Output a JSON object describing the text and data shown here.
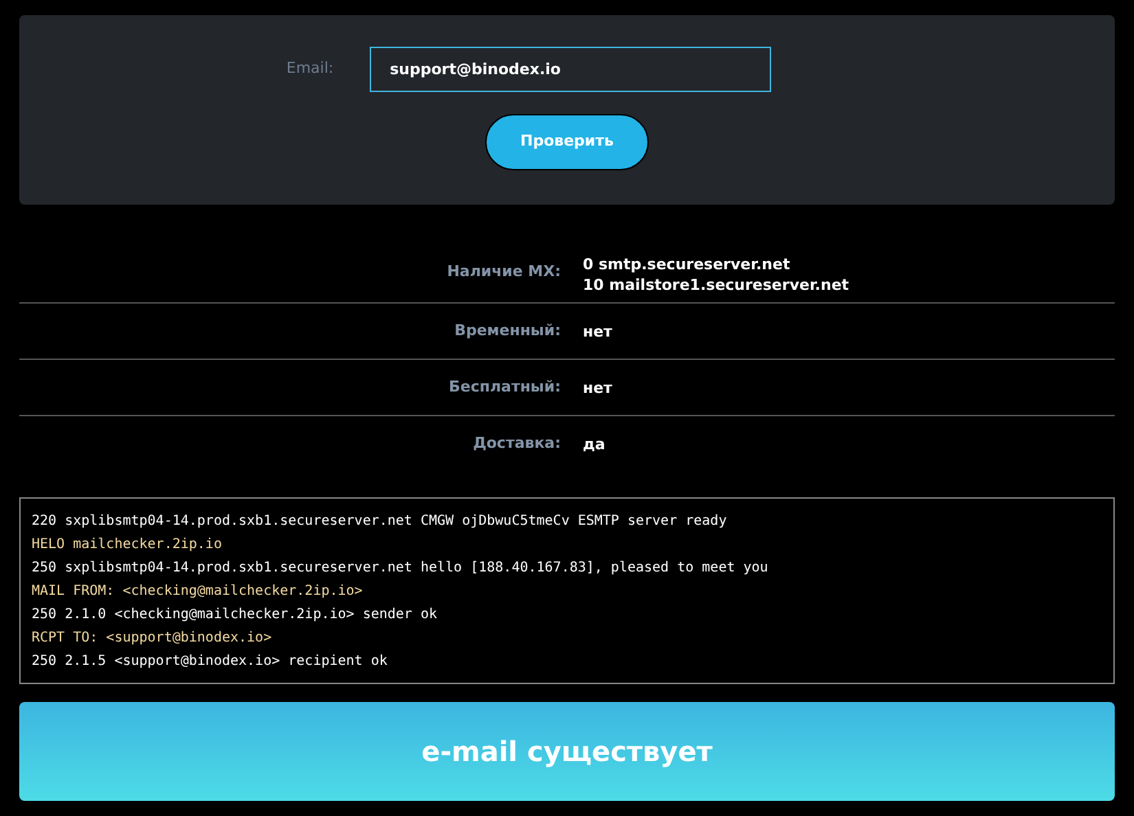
{
  "form": {
    "label": "Email:",
    "value": "support@binodex.io",
    "button": "Проверить"
  },
  "results": [
    {
      "label": "Наличие MX:",
      "values": [
        "0 smtp.secureserver.net",
        "10 mailstore1.secureserver.net"
      ]
    },
    {
      "label": "Временный:",
      "values": [
        "нет"
      ]
    },
    {
      "label": "Бесплатный:",
      "values": [
        "нет"
      ]
    },
    {
      "label": "Доставка:",
      "values": [
        "да"
      ]
    }
  ],
  "log": [
    {
      "kind": "server",
      "text": "220 sxplibsmtp04-14.prod.sxb1.secureserver.net CMGW ojDbwuC5tmeCv ESMTP server ready"
    },
    {
      "kind": "client",
      "text": "HELO mailchecker.2ip.io"
    },
    {
      "kind": "server",
      "text": "250 sxplibsmtp04-14.prod.sxb1.secureserver.net hello [188.40.167.83], pleased to meet you"
    },
    {
      "kind": "client",
      "text": "MAIL FROM: <checking@mailchecker.2ip.io>"
    },
    {
      "kind": "server",
      "text": "250 2.1.0 <checking@mailchecker.2ip.io> sender ok"
    },
    {
      "kind": "client",
      "text": "RCPT TO: <support@binodex.io>"
    },
    {
      "kind": "server",
      "text": "250 2.1.5 <support@binodex.io> recipient ok"
    }
  ],
  "verdict": "e-mail существует"
}
